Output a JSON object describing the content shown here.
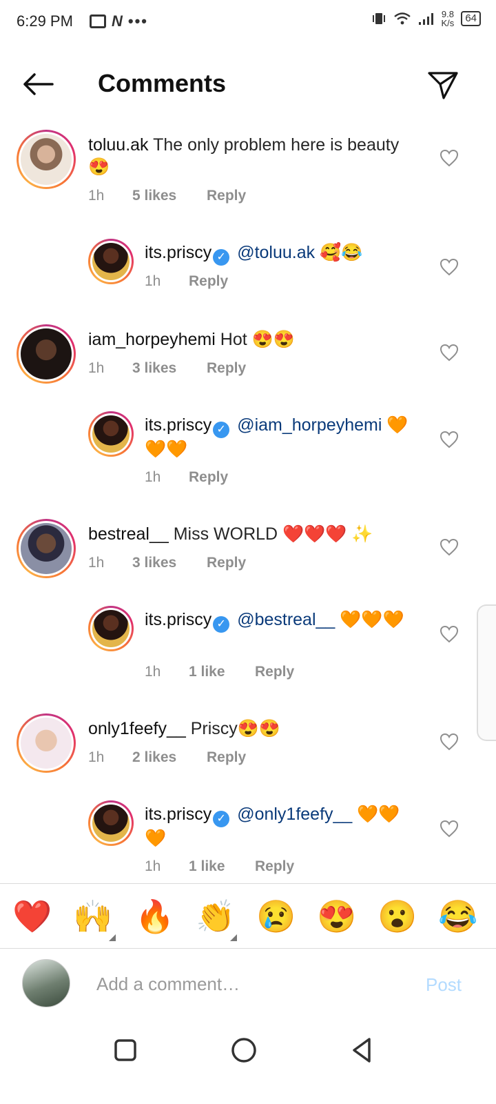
{
  "status_bar": {
    "time": "6:29 PM",
    "speed_value": "9.8",
    "speed_unit": "K/s",
    "battery": "64"
  },
  "header": {
    "title": "Comments"
  },
  "comments": [
    {
      "username": "toluu.ak",
      "text": "The only problem here is beauty😍",
      "time": "1h",
      "likes": "5 likes",
      "reply": "Reply"
    },
    {
      "username": "its.priscy",
      "mention": "@toluu.ak",
      "text": "🥰😂",
      "time": "1h",
      "likes": "",
      "reply": "Reply"
    },
    {
      "username": "iam_horpeyhemi",
      "text": "Hot 😍😍",
      "time": "1h",
      "likes": "3 likes",
      "reply": "Reply"
    },
    {
      "username": "its.priscy",
      "mention": "@iam_horpeyhemi",
      "text": "🧡🧡🧡",
      "time": "1h",
      "likes": "",
      "reply": "Reply"
    },
    {
      "username": "bestreal__",
      "text": "Miss WORLD ❤️❤️❤️ ✨",
      "time": "1h",
      "likes": "3 likes",
      "reply": "Reply"
    },
    {
      "username": "its.priscy",
      "mention": "@bestreal__",
      "text": "🧡🧡🧡",
      "time": "1h",
      "likes": "1 like",
      "reply": "Reply"
    },
    {
      "username": "only1feefy__",
      "text": "Priscy😍😍",
      "time": "1h",
      "likes": "2 likes",
      "reply": "Reply"
    },
    {
      "username": "its.priscy",
      "mention": "@only1feefy__",
      "text": "🧡🧡🧡",
      "time": "1h",
      "likes": "1 like",
      "reply": "Reply"
    }
  ],
  "emoji_bar": [
    "❤️",
    "🙌",
    "🔥",
    "👏",
    "😢",
    "😍",
    "😮",
    "😂"
  ],
  "composer": {
    "placeholder": "Add a comment…",
    "post_label": "Post"
  },
  "colors": {
    "mention": "#0a3a7a",
    "verified": "#3897f0",
    "post_disabled": "#b3dbff",
    "meta_gray": "#8e8e8e"
  }
}
